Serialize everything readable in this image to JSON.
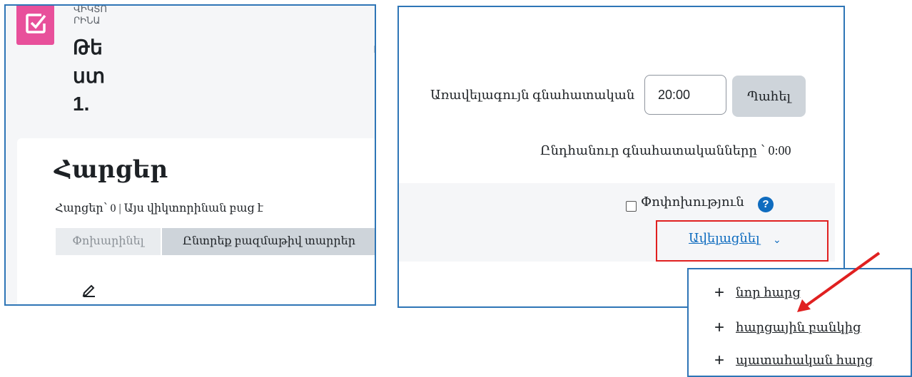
{
  "left_panel": {
    "breadcrumb": [
      "ՎԻԿՏՈ",
      "ՐԻՆԱ"
    ],
    "title_lines": [
      "Թե",
      "ստ",
      "1."
    ],
    "edge_mark": "ւ",
    "heading": "Հարցեր",
    "info": "Հարցեր՝ 0 | Այս վիկտորինան բաց է",
    "reorder_button": "Փոխարինել",
    "select_multiple_button": "Ընտրեք բազմաթիվ տարրեր",
    "logo_icon": "quiz-check-icon",
    "edit_icon": "pencil-icon"
  },
  "right_panel": {
    "max_grade_label": "Առավելագույն գնահատական",
    "max_grade_value": "20:00",
    "save_button": "Պահել",
    "total_marks": "Ընդհանուր գնահատականները ՝ 0:00",
    "shuffle_label": "Փոփոխություն",
    "help_icon": "?",
    "add_button": "Ավելացնել",
    "add_chevron": "⌄"
  },
  "add_menu": {
    "items": [
      {
        "icon": "+",
        "label": "նոր հարց"
      },
      {
        "icon": "+",
        "label": "հարցային բանկից"
      },
      {
        "icon": "+",
        "label": "պատահական հարց"
      }
    ]
  },
  "colors": {
    "logo_bg": "#e8509b",
    "panel_border": "#2e75b6",
    "highlight": "#e02020",
    "link": "#0f6cbf",
    "button_grey": "#ced4da"
  }
}
